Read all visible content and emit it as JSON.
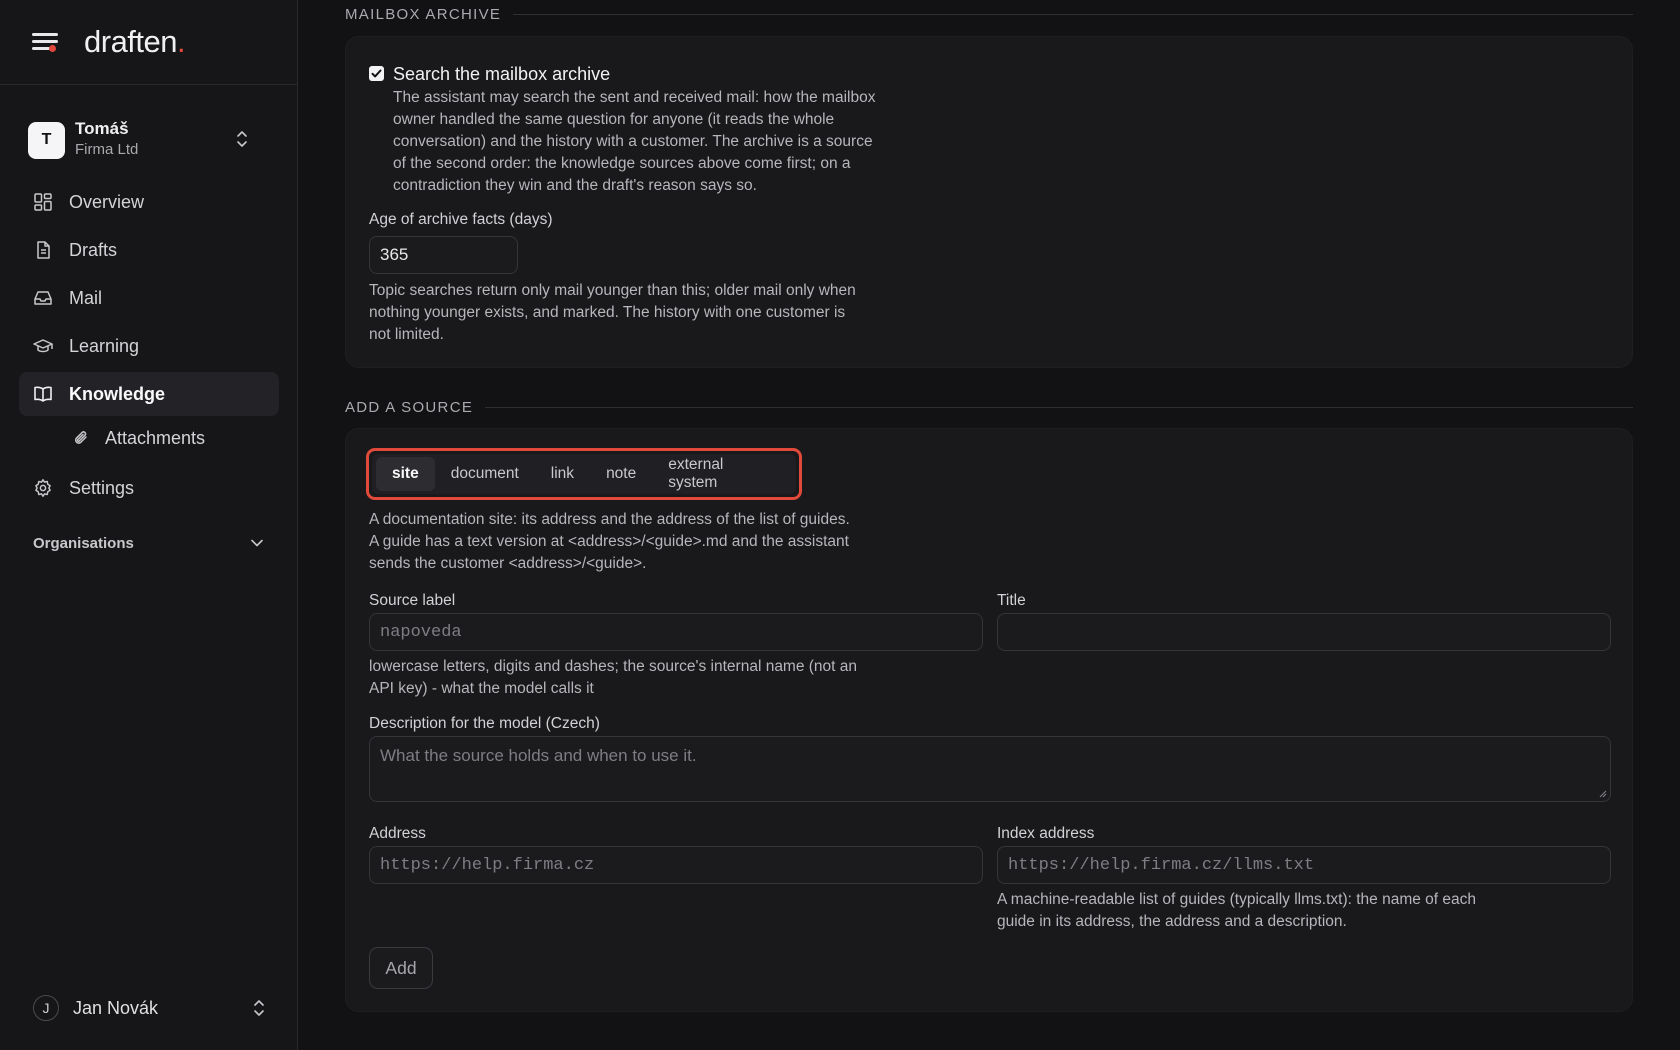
{
  "app": {
    "logo_text": "draften",
    "logo_dot": ".",
    "accent_color": "#e2473b"
  },
  "org_switcher": {
    "avatar_letter": "T",
    "name": "Tomáš",
    "company": "Firma Ltd"
  },
  "nav": {
    "items": [
      {
        "label": "Overview",
        "icon": "dashboard-icon"
      },
      {
        "label": "Drafts",
        "icon": "document-icon"
      },
      {
        "label": "Mail",
        "icon": "inbox-icon"
      },
      {
        "label": "Learning",
        "icon": "graduation-cap-icon"
      },
      {
        "label": "Knowledge",
        "icon": "book-icon",
        "active": true
      },
      {
        "label": "Attachments",
        "icon": "paperclip-icon",
        "sub": true
      },
      {
        "label": "Settings",
        "icon": "gear-icon"
      }
    ],
    "organisations_label": "Organisations"
  },
  "user": {
    "avatar_letter": "J",
    "name": "Jan Novák"
  },
  "archive_section": {
    "heading": "MAILBOX ARCHIVE",
    "checkbox_checked": true,
    "checkbox_label": "Search the mailbox archive",
    "checkbox_help": [
      "The assistant may search the sent and received mail: how the mailbox",
      "owner handled the same question for anyone (it reads the whole",
      "conversation) and the history with a customer. The archive is a source",
      "of the second order: the knowledge sources above come first; on a",
      "contradiction they win and the draft's reason says so."
    ],
    "age_label": "Age of archive facts (days)",
    "age_value": "365",
    "age_help": [
      "Topic searches return only mail younger than this; older mail only when",
      "nothing younger exists, and marked. The history with one customer is",
      "not limited."
    ]
  },
  "add_source": {
    "heading": "ADD A SOURCE",
    "tabs": [
      "site",
      "document",
      "link",
      "note",
      "external system"
    ],
    "active_tab": "site",
    "description": [
      "A documentation site: its address and the address of the list of guides.",
      "A guide has a text version at <address>/<guide>.md and the assistant",
      "sends the customer <address>/<guide>."
    ],
    "source_label_label": "Source label",
    "source_label_placeholder": "napoveda",
    "source_label_help": [
      "lowercase letters, digits and dashes; the source's internal name (not an",
      "API key) - what the model calls it"
    ],
    "title_label": "Title",
    "title_value": "",
    "description_label": "Description for the model (Czech)",
    "description_placeholder": "What the source holds and when to use it.",
    "address_label": "Address",
    "address_placeholder": "https://help.firma.cz",
    "index_label": "Index address",
    "index_placeholder": "https://help.firma.cz/llms.txt",
    "index_help": [
      "A machine-readable list of guides (typically llms.txt): the name of each",
      "guide in its address, the address and a description."
    ],
    "add_button": "Add"
  }
}
